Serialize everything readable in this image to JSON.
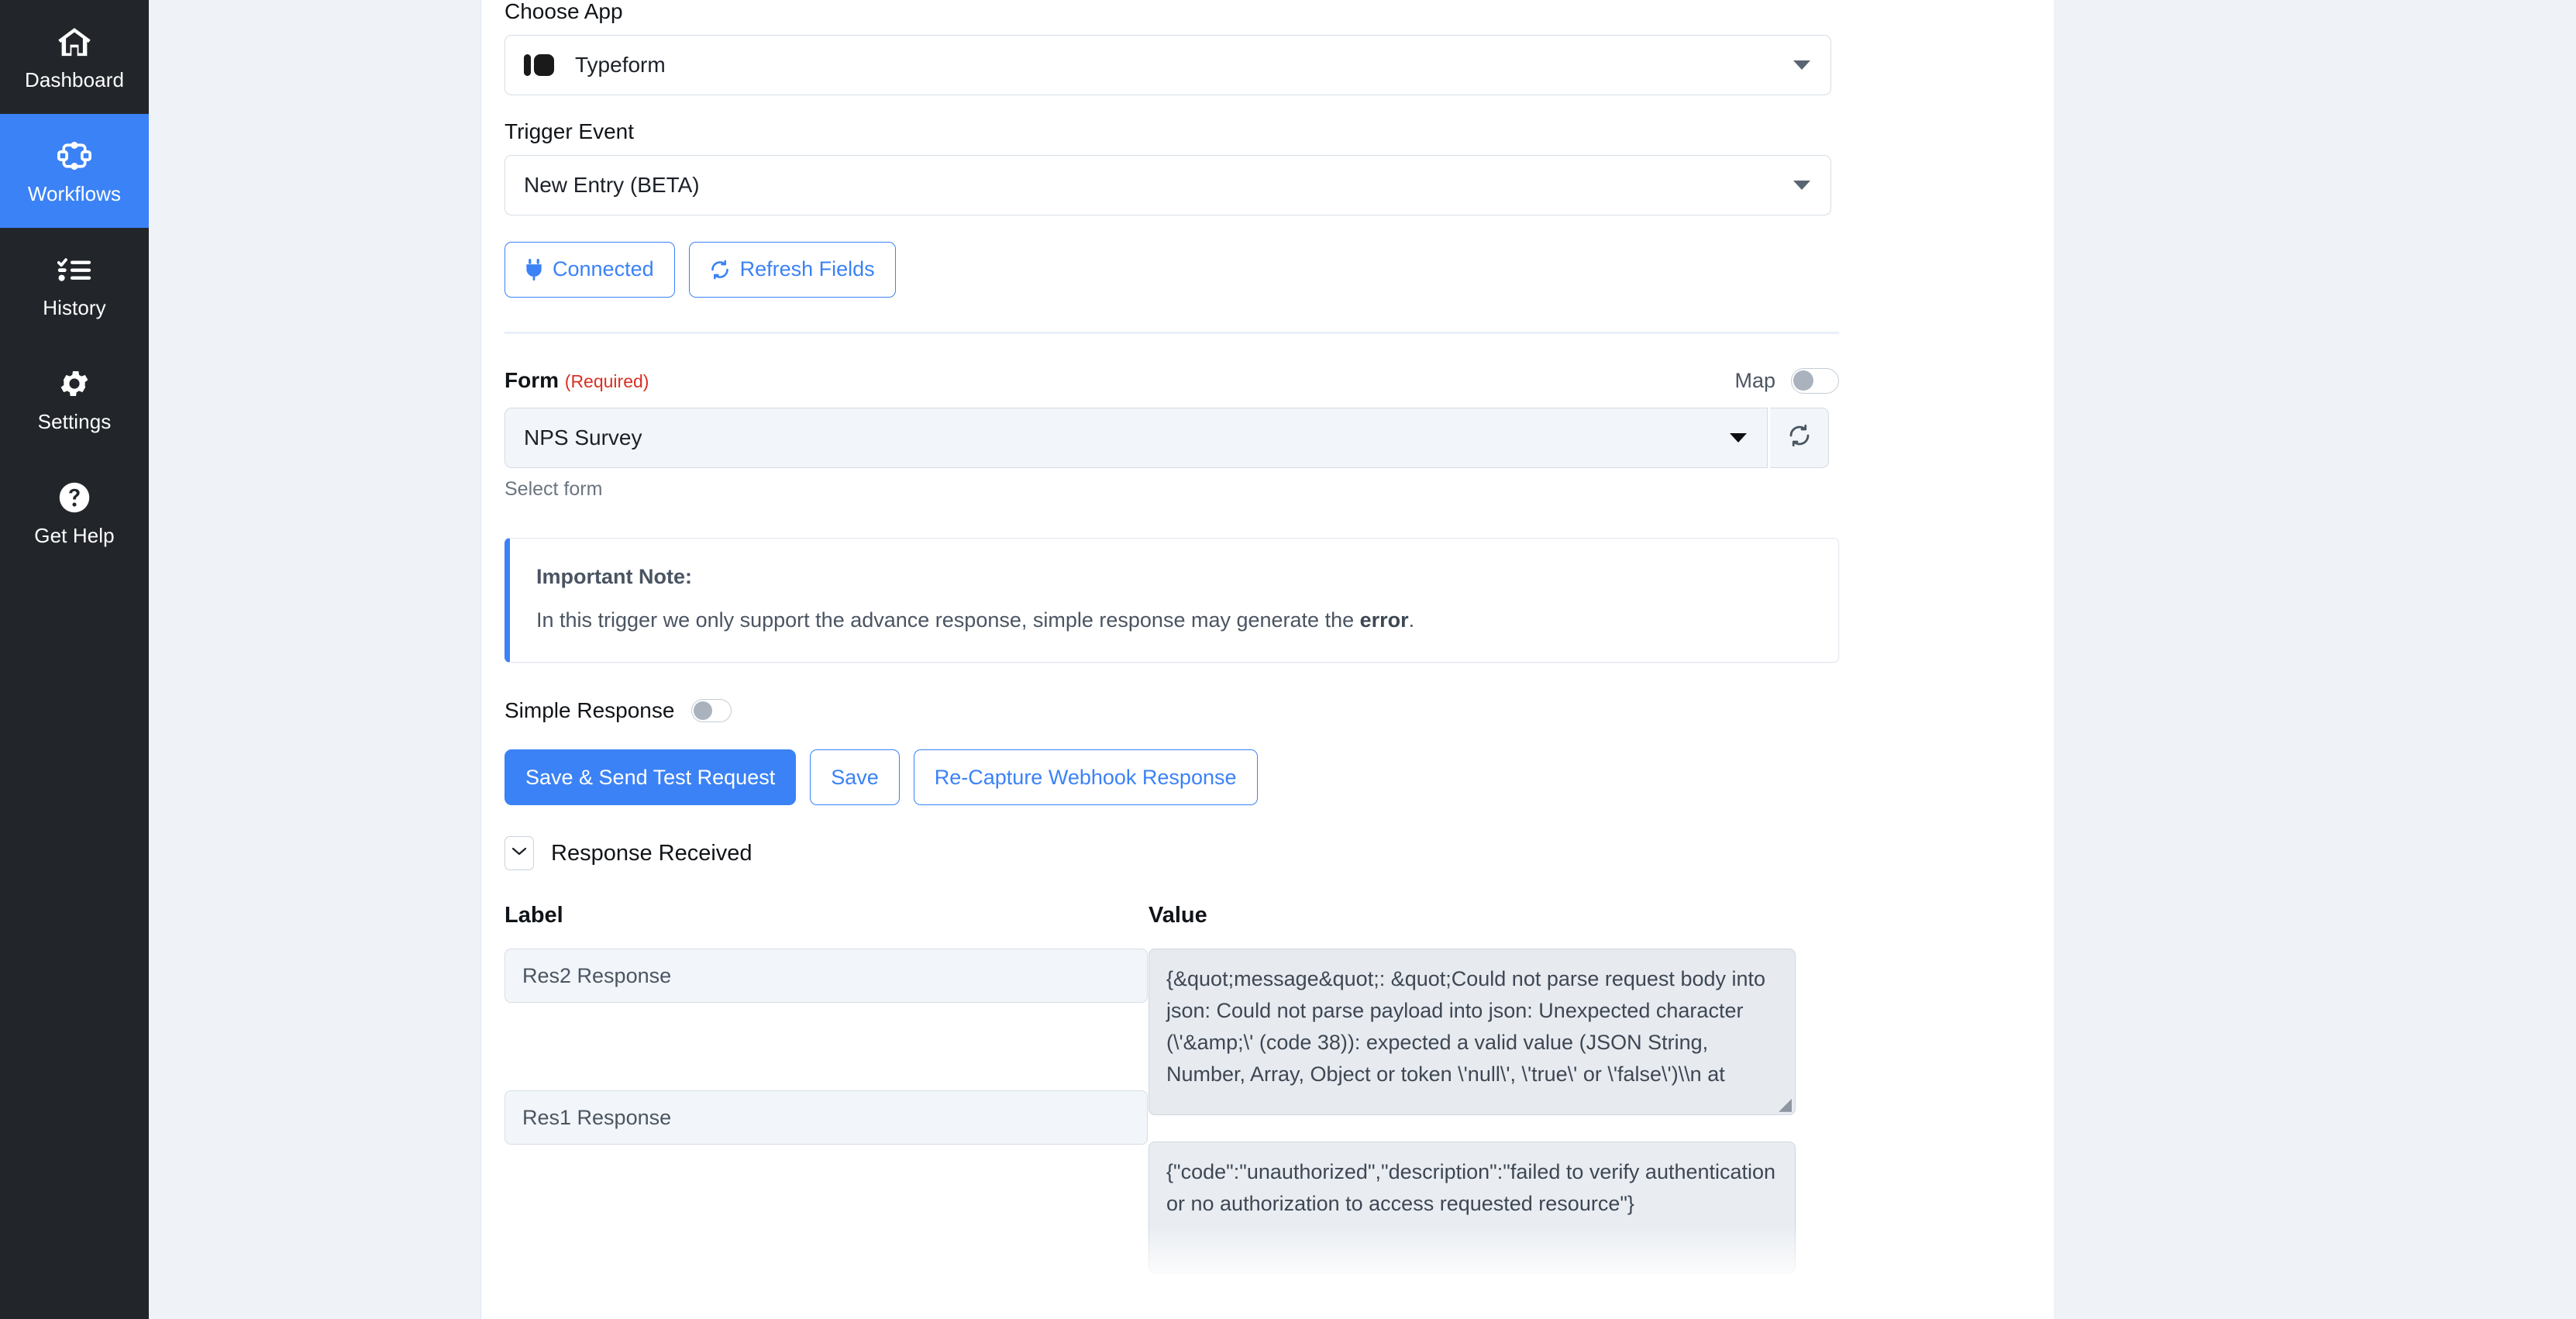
{
  "sidebar": {
    "items": [
      {
        "id": "dashboard",
        "label": "Dashboard",
        "icon": "home-icon",
        "active": false
      },
      {
        "id": "workflows",
        "label": "Workflows",
        "icon": "workflow-icon",
        "active": true
      },
      {
        "id": "history",
        "label": "History",
        "icon": "history-list-icon",
        "active": false
      },
      {
        "id": "settings",
        "label": "Settings",
        "icon": "gear-icon",
        "active": false
      },
      {
        "id": "gethelp",
        "label": "Get Help",
        "icon": "question-circle-icon",
        "active": false
      }
    ],
    "active_color": "#3b82f6",
    "background_color": "#22262b"
  },
  "form": {
    "choose_app": {
      "label": "Choose App",
      "value": "Typeform",
      "icon": "typeform-icon"
    },
    "trigger_event": {
      "label": "Trigger Event",
      "value": "New Entry (BETA)"
    },
    "actions": {
      "connected_label": "Connected",
      "connected_icon": "plug-icon",
      "refresh_fields_label": "Refresh Fields",
      "refresh_fields_icon": "refresh-icon"
    },
    "form_field": {
      "label": "Form",
      "required_label": "(Required)",
      "value": "NPS Survey",
      "helper": "Select form",
      "map_label": "Map",
      "map_enabled": false,
      "refresh_icon": "refresh-icon"
    },
    "note": {
      "title": "Important Note:",
      "body_before": "In this trigger we only support the advance response, simple response may generate the ",
      "body_strong": "error",
      "body_after": "."
    },
    "simple_response": {
      "label": "Simple Response",
      "enabled": false
    },
    "buttons": {
      "save_send_test": "Save & Send Test Request",
      "save": "Save",
      "recapture": "Re-Capture Webhook Response"
    }
  },
  "response_received": {
    "title": "Response Received",
    "expanded": true,
    "chevron_icon": "chevron-down-icon",
    "columns": {
      "label": "Label",
      "value": "Value"
    },
    "rows": [
      {
        "label": "Res2 Response",
        "value": "{&quot;message&quot;: &quot;Could not parse request body into json: Could not parse payload into json: Unexpected character (\\'&amp;\\' (code 38)): expected a valid value (JSON String, Number, Array, Object or token \\'null\\', \\'true\\' or \\'false\\')\\\\n at"
      },
      {
        "label": "Res1 Response",
        "value": "{\"code\":\"unauthorized\",\"description\":\"failed to verify authentication or no authorization to access requested resource\"}"
      }
    ]
  },
  "theme": {
    "accent": "#3b82f6",
    "required_red": "#d93025",
    "panel_bg": "#ffffff",
    "page_bg": "#eff3f8",
    "input_bg": "#f2f6fa",
    "textarea_bg": "#e7ebf0"
  }
}
